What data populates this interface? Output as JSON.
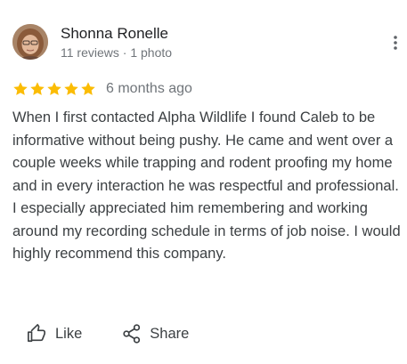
{
  "review": {
    "author_name": "Shonna Ronelle",
    "author_meta": "11 reviews · 1 photo",
    "rating": 5,
    "rating_max": 5,
    "date": "6 months ago",
    "text": "When I first contacted Alpha Wildlife I found Caleb to be informative without being pushy. He came and went over a couple weeks while trapping and rodent proofing my home and in every interaction he was respectful and professional. I especially appreciated him remembering and working around my recording schedule in terms of job noise. I would highly recommend this company."
  },
  "actions": {
    "like_label": "Like",
    "share_label": "Share"
  },
  "icons": {
    "more": "more-vert-icon",
    "star": "star-icon",
    "like": "thumbs-up-icon",
    "share": "share-icon"
  },
  "colors": {
    "star": "#fbbc04",
    "text": "#3c4043",
    "secondary": "#70757a"
  }
}
